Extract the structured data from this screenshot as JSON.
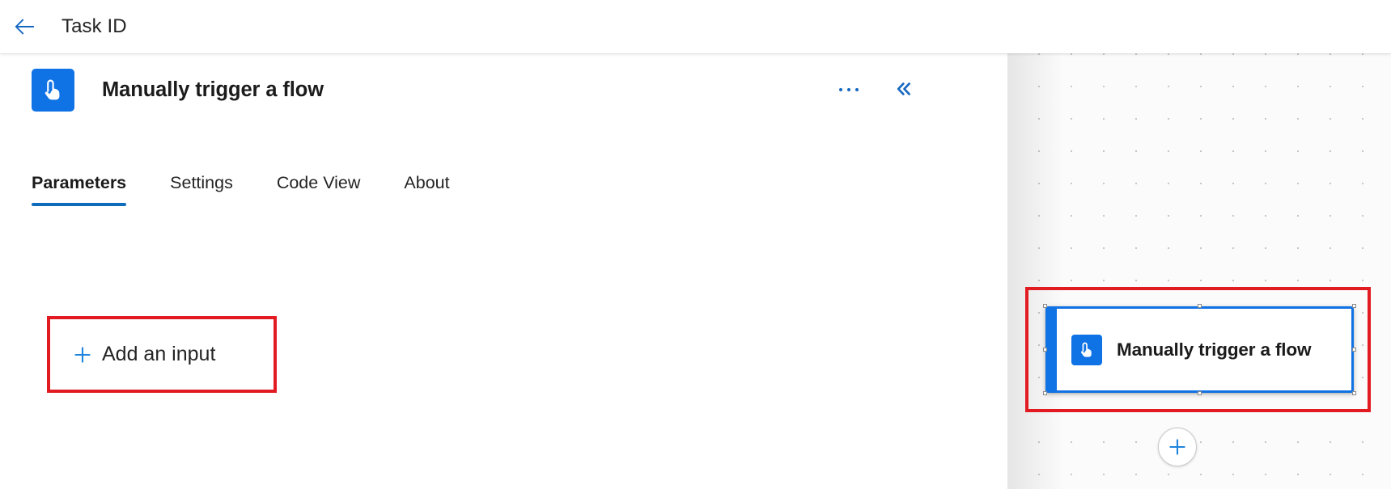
{
  "topbar": {
    "back_icon": "arrow-left-icon",
    "title": "Task ID"
  },
  "panel": {
    "icon": "manual-trigger-tap-icon",
    "title": "Manually trigger a flow",
    "actions": {
      "more_icon": "ellipsis-horizontal-icon",
      "more_label": "...",
      "collapse_icon": "double-chevron-left-icon",
      "collapse_label": "«"
    },
    "tabs": [
      {
        "label": "Parameters",
        "active": true
      },
      {
        "label": "Settings",
        "active": false
      },
      {
        "label": "Code View",
        "active": false
      },
      {
        "label": "About",
        "active": false
      }
    ],
    "parameters": {
      "add_input": {
        "icon": "plus-icon",
        "label": "Add an input"
      }
    }
  },
  "canvas": {
    "node": {
      "icon": "manual-trigger-tap-icon",
      "label": "Manually trigger a flow",
      "selected": true
    },
    "add_step": {
      "icon": "plus-icon",
      "label": "+"
    }
  },
  "colors": {
    "accent_blue": "#0F6CBD",
    "icon_blue": "#0F72E5",
    "annotation_red": "#E21B22",
    "text_primary": "#242424",
    "canvas_bg": "#FBFBFB"
  }
}
